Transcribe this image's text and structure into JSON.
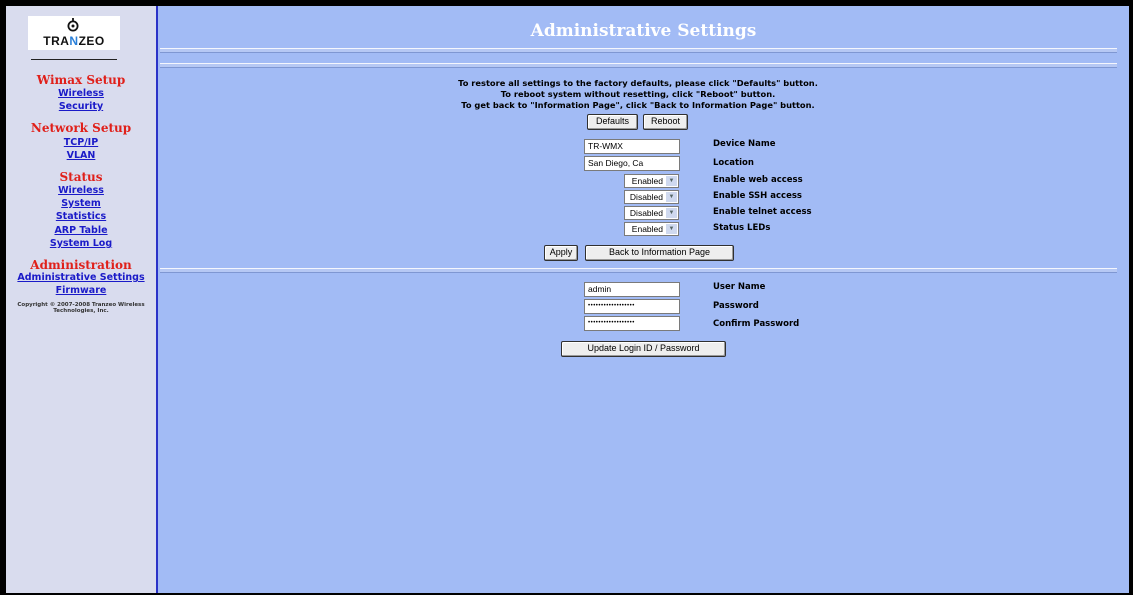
{
  "logo": {
    "text_pre": "TRA",
    "text_n": "N",
    "text_post": "ZEO"
  },
  "sidebar": {
    "wimax": {
      "title": "Wimax Setup",
      "links": [
        "Wireless",
        "Security"
      ]
    },
    "network": {
      "title": "Network Setup",
      "links": [
        "TCP/IP",
        "VLAN"
      ]
    },
    "status": {
      "title": "Status",
      "links": [
        "Wireless",
        "System",
        "Statistics",
        "ARP Table",
        "System Log"
      ]
    },
    "admin": {
      "title": "Administration",
      "links": [
        "Administrative Settings",
        "Firmware"
      ]
    },
    "copyright": [
      "Copyright © 2007-2008 Tranzeo Wireless",
      "Technologies, Inc."
    ]
  },
  "main": {
    "title": "Administrative Settings",
    "instructions": [
      "To restore all settings to the factory defaults, please click \"Defaults\" button.",
      "To reboot system without resetting, click \"Reboot\" button.",
      "To get back to \"Information Page\", click \"Back to Information Page\" button."
    ],
    "defaults_label": "Defaults",
    "reboot_label": "Reboot",
    "device_name": {
      "value": "TR-WMX",
      "label": "Device Name"
    },
    "location": {
      "value": "San Diego, Ca",
      "label": "Location"
    },
    "web_access": {
      "value": "Enabled",
      "label": "Enable web access"
    },
    "ssh_access": {
      "value": "Disabled",
      "label": "Enable SSH access"
    },
    "telnet_access": {
      "value": "Disabled",
      "label": "Enable telnet access"
    },
    "status_leds": {
      "value": "Enabled",
      "label": "Status LEDs"
    },
    "apply_label": "Apply",
    "back_label": "Back to Information Page",
    "user_name": {
      "value": "admin",
      "label": "User Name"
    },
    "password": {
      "value": "••••••••••••••••••",
      "label": "Password"
    },
    "confirm_password": {
      "value": "••••••••••••••••••",
      "label": "Confirm Password"
    },
    "update_label": "Update Login ID / Password"
  },
  "icons": {
    "logo_mark": "tranzeo-swirl-icon",
    "dropdown": "chevron-down-icon"
  },
  "colors": {
    "page_bg": "#a2bbf5",
    "sidebar_bg": "#d9dcee",
    "section_title": "#e0201a",
    "link": "#1a1ac8",
    "title": "#ffffff"
  }
}
